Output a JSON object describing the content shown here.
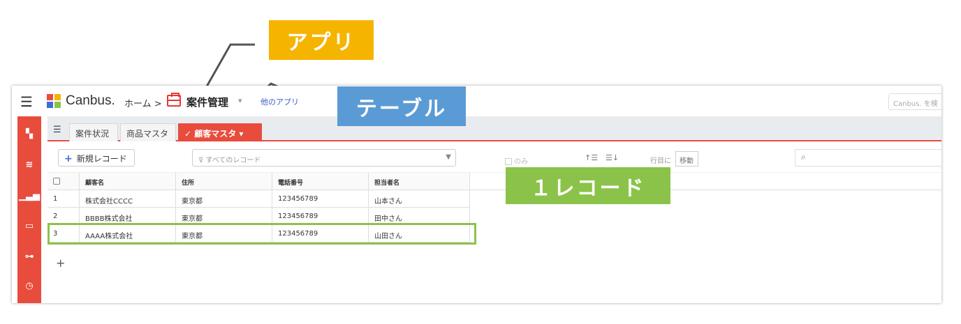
{
  "callouts": {
    "app": "アプリ",
    "table": "テーブル",
    "record": "１レコード"
  },
  "colors": {
    "app_callout": "#f5b400",
    "table_callout": "#5b9bd5",
    "record_callout": "#8bc34a",
    "accent": "#e84c3d"
  },
  "topbar": {
    "logo": "Canbus.",
    "breadcrumb_home": "ホーム >",
    "app_name": "案件管理",
    "app_caret": "▾",
    "other_apps": "他のアプリ",
    "search_placeholder": "Canbus. を検"
  },
  "sidebar": {
    "icons": [
      "dashboard-icon",
      "database-icon",
      "chart-icon",
      "card-icon",
      "flow-icon",
      "history-icon"
    ]
  },
  "tabs": [
    {
      "label": "案件状況"
    },
    {
      "label": "商品マスタ"
    },
    {
      "label": "✓ 顧客マスタ ▾",
      "active": true
    }
  ],
  "toolbar": {
    "new_record": "新規レコード",
    "filter": "すべてのレコード",
    "only": "のみ",
    "goto_label": "行目に",
    "goto_button": "移動"
  },
  "grid": {
    "columns": [
      "顧客名",
      "住所",
      "電話番号",
      "担当者名"
    ],
    "rows": [
      {
        "no": "1",
        "name": "株式会社CCCC",
        "address": "東京都",
        "phone": "123456789",
        "owner": "山本さん"
      },
      {
        "no": "2",
        "name": "BBBB株式会社",
        "address": "東京都",
        "phone": "123456789",
        "owner": "田中さん"
      },
      {
        "no": "3",
        "name": "AAAA株式会社",
        "address": "東京都",
        "phone": "123456789",
        "owner": "山田さん"
      }
    ],
    "add": "+"
  }
}
